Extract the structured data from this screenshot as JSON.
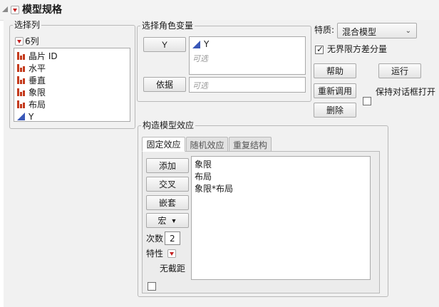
{
  "header": {
    "title": "模型规格",
    "collapse_icon": "collapse-triangle-icon",
    "menu_icon": "red-triangle-menu-icon"
  },
  "colors": {
    "accent_red": "#c42020",
    "nominal_icon": "#c43a1c",
    "continuous_icon": "#3a58b8"
  },
  "select_columns": {
    "legend": "选择列",
    "count_label": "6列",
    "columns": [
      {
        "name": "晶片 ID",
        "type": "nominal"
      },
      {
        "name": "水平",
        "type": "nominal"
      },
      {
        "name": "垂直",
        "type": "nominal"
      },
      {
        "name": "象限",
        "type": "nominal"
      },
      {
        "name": "布局",
        "type": "nominal"
      },
      {
        "name": "Y",
        "type": "continuous"
      }
    ]
  },
  "roles": {
    "legend": "选择角色变量",
    "y_button": "Y",
    "y_value": "Y",
    "y_optional": "可选",
    "by_button": "依据",
    "by_optional": "可选"
  },
  "personality": {
    "label": "特质:",
    "value": "混合模型"
  },
  "unbounded": {
    "label": "无界限方差分量",
    "checked": true
  },
  "actions": {
    "help": "帮助",
    "run": "运行",
    "recall": "重新调用",
    "keep_open": "保持对话框打开",
    "keep_open_checked": false,
    "remove": "删除"
  },
  "construct": {
    "legend": "构造模型效应",
    "tabs": [
      "固定效应",
      "随机效应",
      "重复结构"
    ],
    "active_tab": 0,
    "add": "添加",
    "cross": "交叉",
    "nest": "嵌套",
    "macros": "宏",
    "degree_label": "次数",
    "degree_value": "2",
    "attributes_label": "特性",
    "no_intercept": "无截距",
    "no_intercept_checked": false,
    "effects": [
      "象限",
      "布局",
      "象限*布局"
    ]
  }
}
